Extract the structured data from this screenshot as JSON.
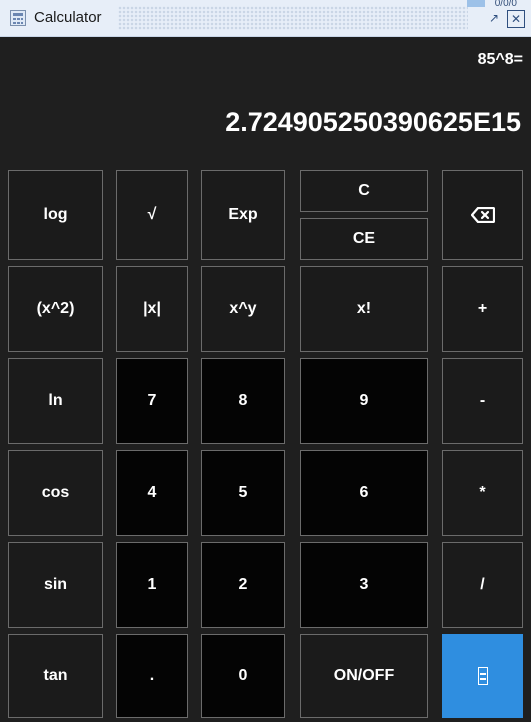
{
  "window": {
    "title": "Calculator",
    "overlay_text": "0/0/0"
  },
  "display": {
    "expression": "85^8=",
    "result": "2.724905250390625E15"
  },
  "buttons": {
    "log": "log",
    "sqrt": "√",
    "exp": "Exp",
    "c": "C",
    "ce": "CE",
    "backspace_icon": "backspace-icon",
    "square": "(x^2)",
    "abs": "|x|",
    "pow": "x^y",
    "fact": "x!",
    "plus": "+",
    "ln": "ln",
    "n7": "7",
    "n8": "8",
    "n9": "9",
    "minus": "-",
    "cos": "cos",
    "n4": "4",
    "n5": "5",
    "n6": "6",
    "mul": "*",
    "sin": "sin",
    "n1": "1",
    "n2": "2",
    "n3": "3",
    "div": "/",
    "tan": "tan",
    "dot": ".",
    "n0": "0",
    "onoff": "ON/OFF"
  },
  "colors": {
    "background": "#1f1f1f",
    "button": "#1b1b1b",
    "number_button": "#040404",
    "border": "#6b6b6b",
    "equals": "#2f8ee0",
    "titlebar": "#e7eef8"
  }
}
